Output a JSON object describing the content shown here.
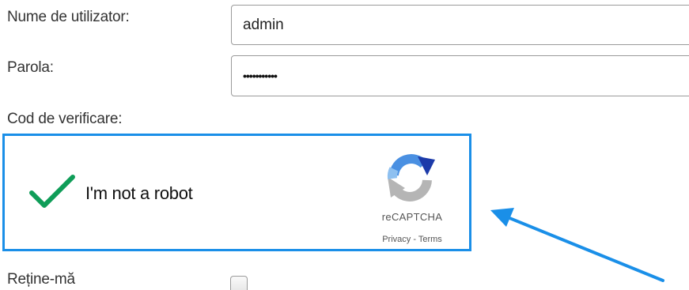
{
  "form": {
    "username_label": "Nume de utilizator:",
    "username_value": "admin",
    "password_label": "Parola:",
    "password_masked": "•••••••••••",
    "verification_label": "Cod de verificare:",
    "remember_label": "Reține-mă",
    "remember_checked": false
  },
  "captcha": {
    "checkbox_label": "I'm not a robot",
    "checked": true,
    "brand": "reCAPTCHA",
    "privacy_label": "Privacy",
    "separator": " - ",
    "terms_label": "Terms",
    "highlight_color": "#1a8fe8",
    "check_color": "#0f9d58"
  },
  "annotation": {
    "arrow_color": "#1a8fe8",
    "arrow_icon": "arrow-pointing-up-left-icon"
  }
}
